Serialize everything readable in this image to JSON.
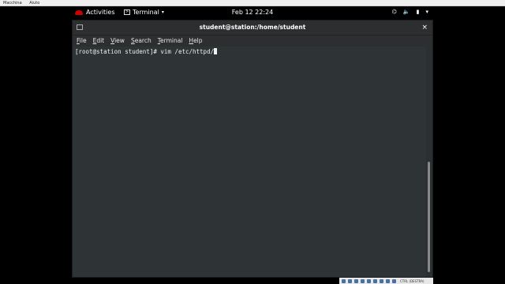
{
  "vbox": {
    "menu": [
      "Macchina",
      "Aiuto"
    ],
    "host_key": "CTRL (DESTRA)"
  },
  "topbar": {
    "activities": "Activities",
    "app_name": "Terminal",
    "clock": "Feb 12  22:24"
  },
  "window": {
    "title": "student@station:/home/student",
    "close_label": "×"
  },
  "menu": {
    "items": [
      "File",
      "Edit",
      "View",
      "Search",
      "Terminal",
      "Help"
    ]
  },
  "terminal": {
    "line1": "[root@station student]# vim /etc/httpd/"
  },
  "colors": {
    "terminal_bg": "#2e3436",
    "redhat": "#cc0000"
  }
}
